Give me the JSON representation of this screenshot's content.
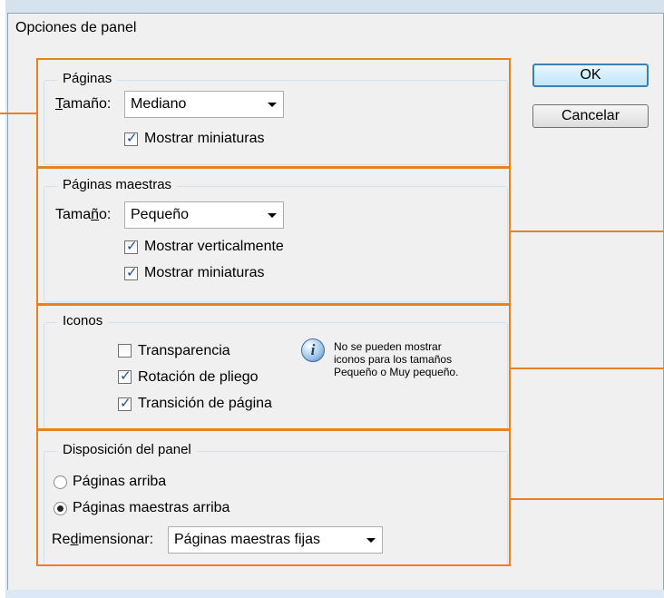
{
  "window": {
    "title": "Opciones de panel"
  },
  "buttons": {
    "ok": "OK",
    "cancel": "Cancelar"
  },
  "paginas": {
    "legend": "Páginas",
    "size_label_pre": "",
    "size_label_ul": "T",
    "size_label_post": "amaño:",
    "size_value": "Mediano",
    "show_thumbs": "Mostrar miniaturas"
  },
  "maestras": {
    "legend": "Páginas maestras",
    "size_label_pre": "Tama",
    "size_label_ul": "ñ",
    "size_label_post": "o:",
    "size_value": "Pequeño",
    "show_vertical": "Mostrar verticalmente",
    "show_thumbs": "Mostrar miniaturas"
  },
  "iconos": {
    "legend": "Iconos",
    "transparency": "Transparencia",
    "spread_rotation": "Rotación de pliego",
    "page_transition": "Transición de página",
    "info_line1": "No se pueden mostrar",
    "info_line2": "iconos para los tamaños",
    "info_line3": "Pequeño o Muy pequeño."
  },
  "disposicion": {
    "legend": "Disposición del panel",
    "pages_top": "Páginas arriba",
    "masters_top": "Páginas maestras arriba",
    "resize_label_pre": "Re",
    "resize_label_ul": "d",
    "resize_label_post": "imensionar:",
    "resize_value": "Páginas maestras fijas"
  },
  "state": {
    "paginas_show_thumbs": true,
    "maestras_show_vertical": true,
    "maestras_show_thumbs": true,
    "transparency": false,
    "spread_rotation": true,
    "page_transition": true,
    "layout_selected": "masters_top"
  },
  "colors": {
    "highlight": "#e8821e",
    "dialog_bg": "#f0f0f0",
    "default_button_border": "#3c7fb1"
  },
  "icons": {
    "info": "info-icon",
    "dropdown": "chevron-down-icon"
  }
}
